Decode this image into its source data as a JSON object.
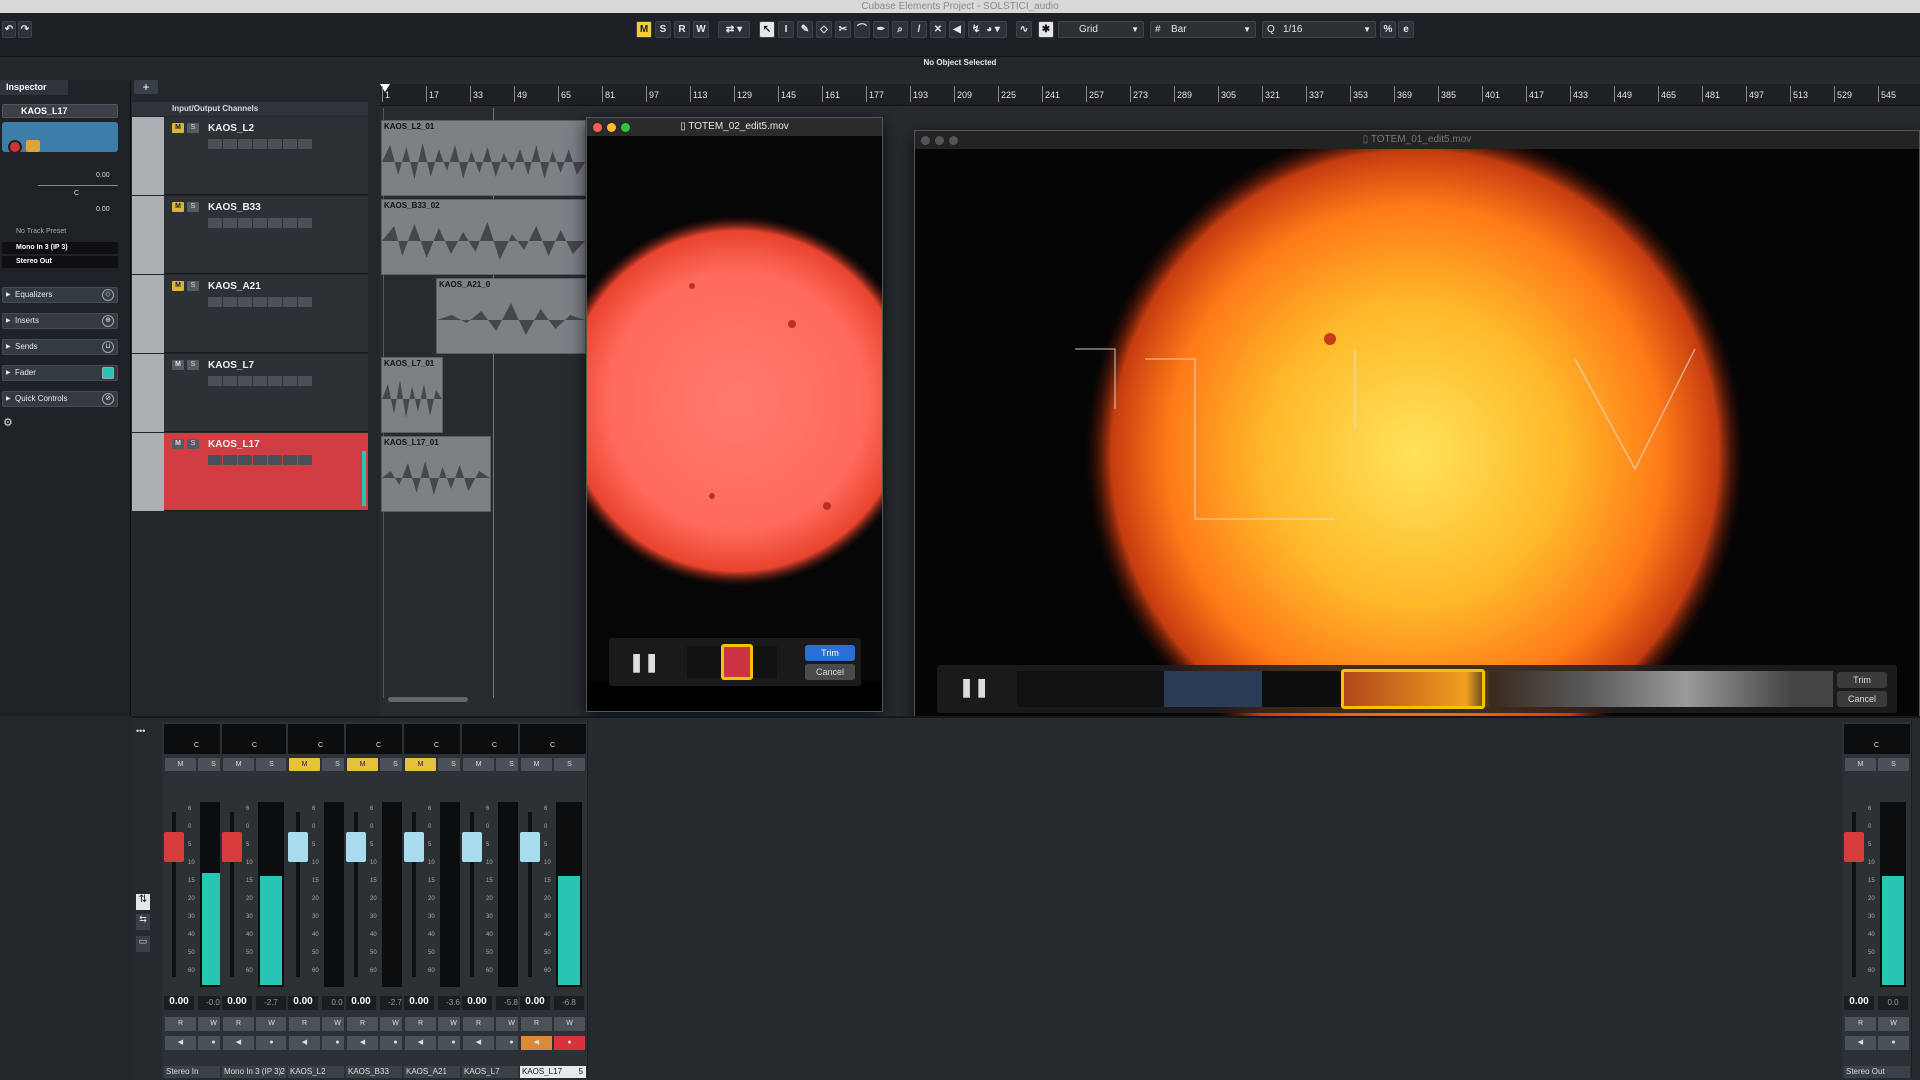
{
  "window_title": "Cubase Elements Project - SOLSTICI_audio",
  "status_text": "No Object Selected",
  "toolbar": {
    "m": "M",
    "s": "S",
    "r": "R",
    "w": "W",
    "snap_type": "Grid",
    "grid_type": "Bar",
    "quantize": "1/16"
  },
  "inspector": {
    "tab": "Inspector",
    "track_name": "KAOS_L17",
    "volume": "0.00",
    "pan": "C",
    "pan_value": "0.00",
    "preset": "No Track Preset",
    "input": "Mono In 3 (IP 3)",
    "output": "Stereo Out",
    "sections": [
      "Equalizers",
      "Inserts",
      "Sends",
      "Fader",
      "Quick Controls"
    ]
  },
  "tracklist": {
    "folder": "Input/Output Channels",
    "tracks": [
      {
        "num": "1",
        "name": "KAOS_L2",
        "clip": "KAOS_L2_01"
      },
      {
        "num": "2",
        "name": "KAOS_B33",
        "clip": "KAOS_B33_02"
      },
      {
        "num": "3",
        "name": "KAOS_A21",
        "clip": "KAOS_A21_0"
      },
      {
        "num": "4",
        "name": "KAOS_L7",
        "clip": "KAOS_L7_01"
      },
      {
        "num": "5",
        "name": "KAOS_L17",
        "clip": "KAOS_L17_01"
      }
    ]
  },
  "ruler": [
    "1",
    "17",
    "33",
    "49",
    "65",
    "81",
    "97",
    "113",
    "129",
    "145",
    "161",
    "177",
    "193",
    "209",
    "225",
    "241",
    "257",
    "273",
    "289",
    "305",
    "321",
    "337",
    "353",
    "369",
    "385",
    "401",
    "417",
    "433",
    "449",
    "465",
    "481",
    "497",
    "513",
    "529",
    "545"
  ],
  "video1": {
    "title": "TOTEM_02_edit5.mov",
    "trim": "Trim",
    "cancel": "Cancel"
  },
  "video2": {
    "title": "TOTEM_01_edit5.mov",
    "trim": "Trim",
    "cancel": "Cancel"
  },
  "mixer": {
    "channels": [
      {
        "name": "Stereo In",
        "num": "1",
        "vol": "0.00",
        "peak": "-0.0",
        "muted": false,
        "level": 0.62,
        "cap": "red"
      },
      {
        "name": "Mono In 3 (IP 3)",
        "num": "2",
        "vol": "0.00",
        "peak": "-2.7",
        "muted": false,
        "level": 0.6,
        "cap": "red"
      },
      {
        "name": "KAOS_L2",
        "num": "1",
        "vol": "0.00",
        "peak": "0.0",
        "muted": true,
        "level": 0,
        "cap": "blue"
      },
      {
        "name": "KAOS_B33",
        "num": "2",
        "vol": "0.00",
        "peak": "-2.7",
        "muted": true,
        "level": 0,
        "cap": "blue"
      },
      {
        "name": "KAOS_A21",
        "num": "3",
        "vol": "0.00",
        "peak": "-3.6",
        "muted": true,
        "level": 0,
        "cap": "blue"
      },
      {
        "name": "KAOS_L7",
        "num": "4",
        "vol": "0.00",
        "peak": "-5.8",
        "muted": false,
        "level": 0,
        "cap": "blue"
      },
      {
        "name": "KAOS_L17",
        "num": "5",
        "vol": "0.00",
        "peak": "-6.8",
        "muted": false,
        "level": 0.6,
        "cap": "blue"
      },
      {
        "name": "Stereo Out",
        "num": "",
        "vol": "0.00",
        "peak": "0.0",
        "muted": false,
        "level": 0.6,
        "cap": "red"
      }
    ],
    "scale": [
      "6",
      "0",
      "5",
      "10",
      "15",
      "20",
      "30",
      "40",
      "50",
      "60"
    ],
    "m": "M",
    "s": "S",
    "r": "R",
    "w": "W",
    "pan": "C"
  }
}
